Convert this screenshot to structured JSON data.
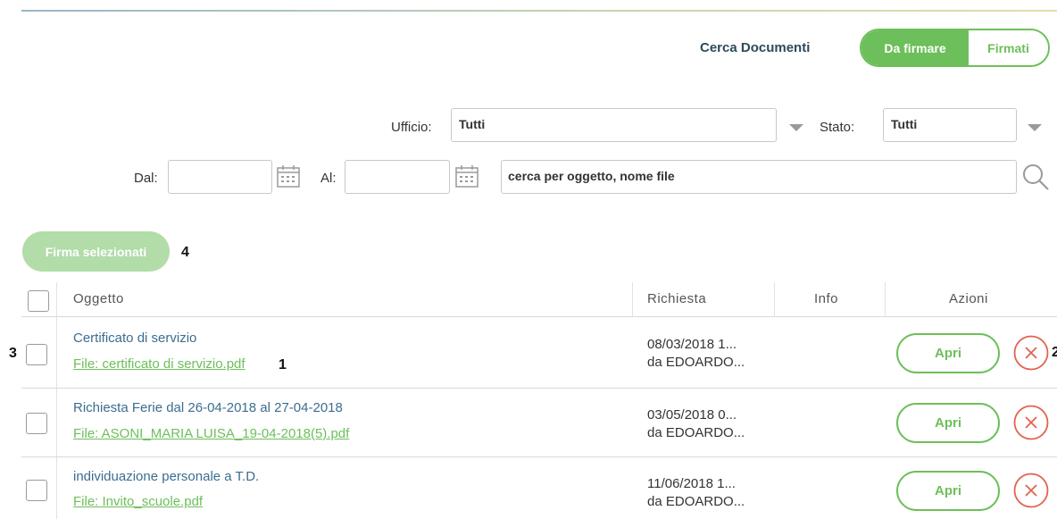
{
  "header": {
    "search_title": "Cerca Documenti",
    "toggle": {
      "active": "Da firmare",
      "inactive": "Firmati"
    }
  },
  "filters": {
    "ufficio_label": "Ufficio:",
    "ufficio_value": "Tutti",
    "stato_label": "Stato:",
    "stato_value": "Tutti",
    "dal_label": "Dal:",
    "dal_value": "",
    "al_label": "Al:",
    "al_value": "",
    "search_value": "cerca per oggetto, nome file"
  },
  "actions": {
    "firma_label": "Firma selezionati",
    "annotation_4": "4"
  },
  "table": {
    "headers": {
      "oggetto": "Oggetto",
      "richiesta": "Richiesta",
      "info": "Info",
      "azioni": "Azioni"
    },
    "rows": [
      {
        "oggetto": "Certificato di servizio",
        "file": "File: certificato di servizio.pdf",
        "richiesta_date": "08/03/2018 1...",
        "richiesta_by": "da EDOARDO...",
        "apri_label": "Apri"
      },
      {
        "oggetto": "Richiesta Ferie dal 26-04-2018 al 27-04-2018",
        "file": "File: ASONI_MARIA LUISA_19-04-2018(5).pdf",
        "richiesta_date": "03/05/2018 0...",
        "richiesta_by": "da EDOARDO...",
        "apri_label": "Apri"
      },
      {
        "oggetto": "individuazione personale a T.D.",
        "file": "File: Invito_scuole.pdf",
        "richiesta_date": "11/06/2018 1...",
        "richiesta_by": "da EDOARDO...",
        "apri_label": "Apri"
      }
    ]
  },
  "annotations": {
    "n1": "1",
    "n2": "2",
    "n3": "3"
  },
  "colors": {
    "green": "#6cbf5a",
    "light_green": "#b2dca8",
    "red": "#e2624f",
    "title": "#2d4a5a",
    "link": "#3b6d8f"
  }
}
